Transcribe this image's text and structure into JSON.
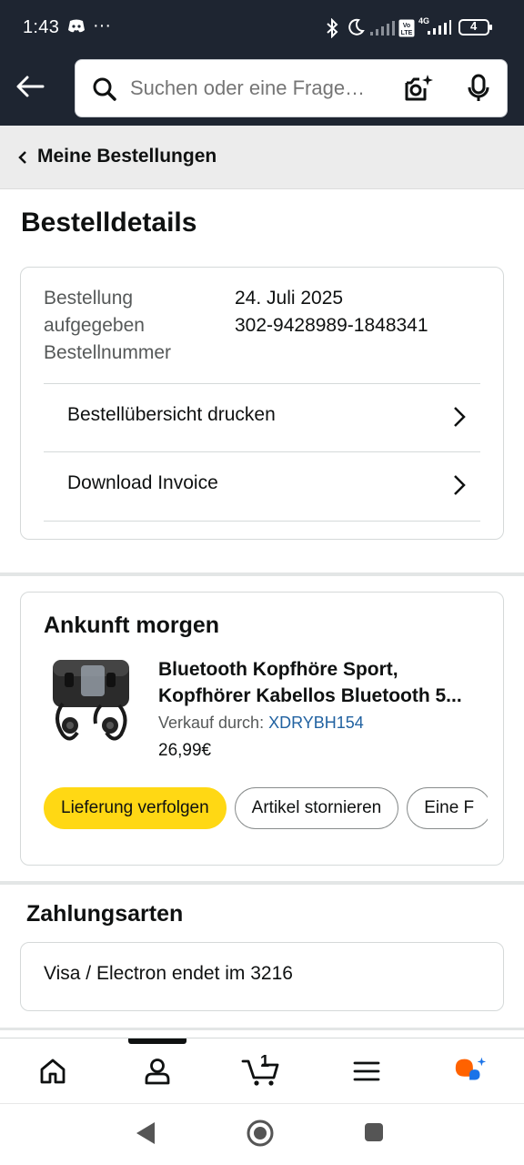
{
  "status_bar": {
    "time": "1:43",
    "dots": "···",
    "battery": "4",
    "network": "4G"
  },
  "search": {
    "placeholder": "Suchen oder eine Frage…"
  },
  "breadcrumb": {
    "label": "Meine Bestellungen"
  },
  "page": {
    "title": "Bestelldetails"
  },
  "order": {
    "placed_label_line1": "Bestellung",
    "placed_label_line2": "aufgegeben",
    "placed_value": "24. Juli 2025",
    "number_label": "Bestellnummer",
    "number_value": "302-9428989-1848341",
    "links": [
      {
        "label": "Bestellübersicht drucken"
      },
      {
        "label": "Download Invoice"
      }
    ]
  },
  "delivery": {
    "title": "Ankunft morgen",
    "product_name_line1": "Bluetooth Kopfhöre Sport,",
    "product_name_line2": "Kopfhörer Kabellos Bluetooth 5...",
    "seller_prefix": "Verkauf durch:",
    "seller_name": "XDRYBH154",
    "price": "26,99€",
    "buttons": [
      {
        "label": "Lieferung verfolgen",
        "style": "primary"
      },
      {
        "label": "Artikel stornieren",
        "style": "secondary"
      },
      {
        "label": "Eine F",
        "style": "secondary"
      }
    ]
  },
  "payment": {
    "title": "Zahlungsarten",
    "method": "Visa / Electron",
    "ending": "endet im 3216"
  },
  "bottom_nav": {
    "cart_count": "1",
    "items": [
      "home-icon",
      "account-icon",
      "cart-icon",
      "menu-icon",
      "rufus-icon"
    ],
    "active": "account-icon"
  },
  "colors": {
    "header_bg": "#1e2531",
    "primary_button": "#ffd814",
    "link": "#2162a1",
    "rufus_orange": "#ff6200",
    "rufus_blue": "#1a73e8"
  }
}
